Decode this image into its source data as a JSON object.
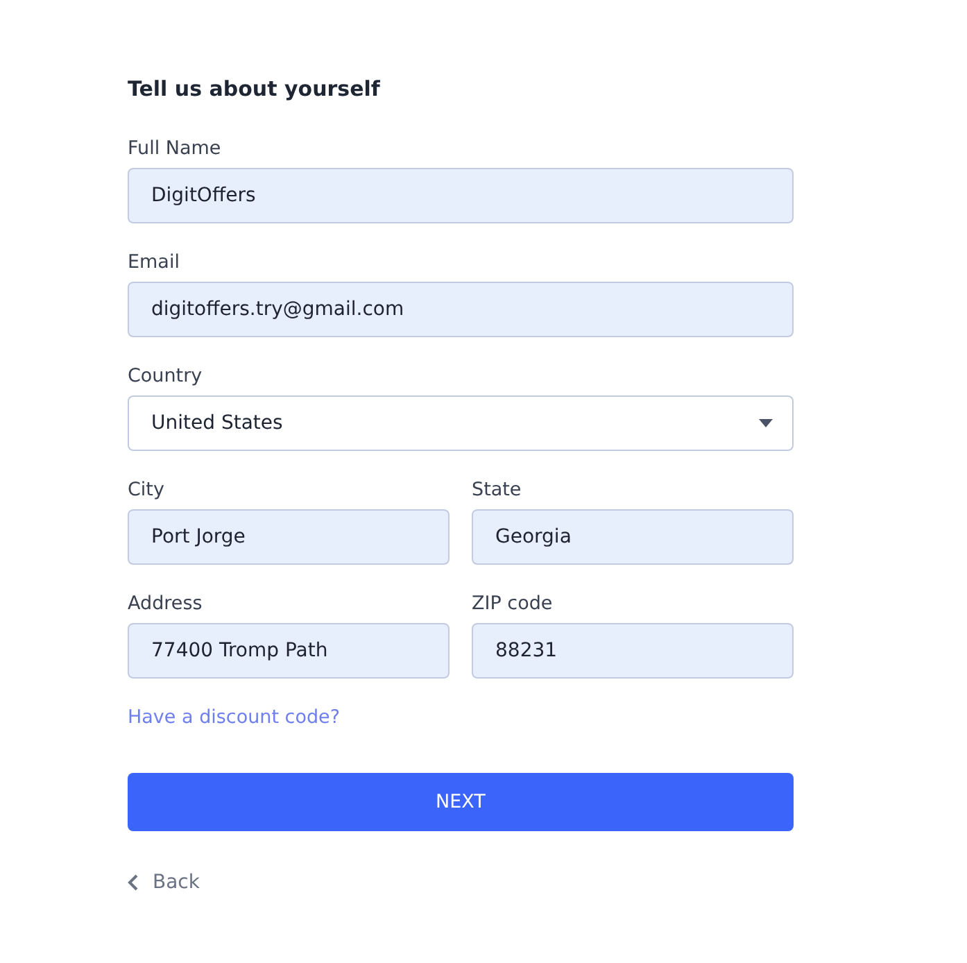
{
  "heading": "Tell us about yourself",
  "rows": [
    [
      {
        "label": "Full Name",
        "kind": "text",
        "value": "DigitOffers"
      }
    ],
    [
      {
        "label": "Email",
        "kind": "text",
        "value": "digitoffers.try@gmail.com"
      }
    ],
    [
      {
        "label": "Country",
        "kind": "select",
        "value": "United States"
      }
    ],
    [
      {
        "label": "City",
        "kind": "text",
        "value": "Port Jorge"
      },
      {
        "label": "State",
        "kind": "text",
        "value": "Georgia"
      }
    ],
    [
      {
        "label": "Address",
        "kind": "text",
        "value": "77400 Tromp Path"
      },
      {
        "label": "ZIP code",
        "kind": "text",
        "value": "88231"
      }
    ]
  ],
  "discount_link": "Have a discount code?",
  "next_button": "NEXT",
  "back_link": "Back"
}
